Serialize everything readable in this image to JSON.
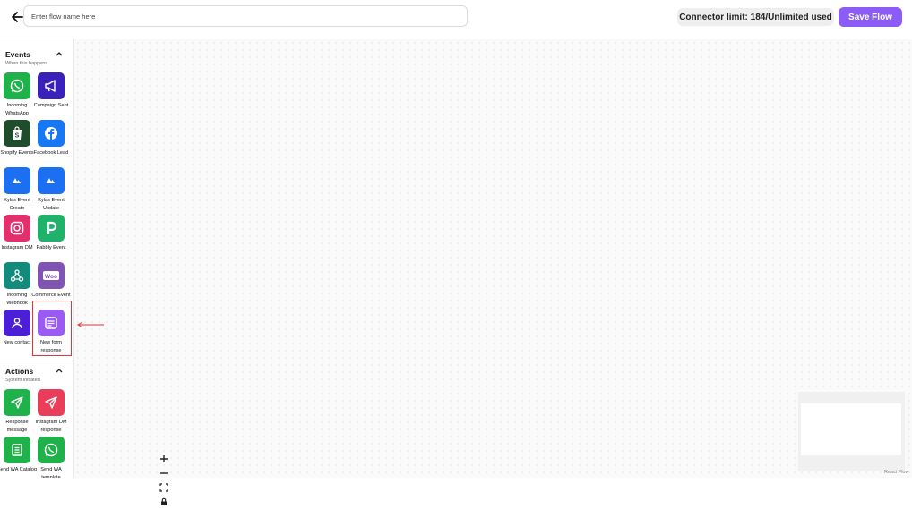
{
  "topbar": {
    "flow_name_placeholder": "Enter flow name here",
    "connector_limit": "Connector limit: 184/Unlimited used",
    "save_label": "Save Flow"
  },
  "colors": {
    "accent": "#8b5cf6",
    "highlight": "#d9363e"
  },
  "sidebar": {
    "events": {
      "title": "Events",
      "subtitle": "When this happens",
      "items": [
        {
          "label": "Incoming WhatsApp",
          "icon": "whatsapp-icon",
          "color": "#1fb14a"
        },
        {
          "label": "Campaign Sent",
          "icon": "megaphone-icon",
          "color": "#3a22b8"
        },
        {
          "label": "Shopify Events",
          "icon": "shopify-icon",
          "color": "#1f4d2b"
        },
        {
          "label": "Facebook Lead",
          "icon": "facebook-icon",
          "color": "#1877f2"
        },
        {
          "label": "Kylas Event Create",
          "icon": "kylas-icon",
          "color": "#1b6ff0"
        },
        {
          "label": "Kylas Event Update",
          "icon": "kylas-icon",
          "color": "#1b6ff0"
        },
        {
          "label": "Instagram DM",
          "icon": "instagram-icon",
          "color": "#e1306c"
        },
        {
          "label": "Pabbly Event",
          "icon": "pabbly-icon",
          "color": "#20b26b"
        },
        {
          "label": "Incoming Webhook",
          "icon": "webhook-icon",
          "color": "#138b7a"
        },
        {
          "label": "Commerce Event",
          "icon": "woo-icon",
          "color": "#7f54b3"
        },
        {
          "label": "New contact",
          "icon": "person-icon",
          "color": "#4b1fd6"
        },
        {
          "label": "New form response",
          "icon": "form-icon",
          "color": "#9a5bf0"
        }
      ]
    },
    "actions": {
      "title": "Actions",
      "subtitle": "System initiated",
      "items": [
        {
          "label": "Response message",
          "icon": "send-icon",
          "color": "#1fb14a"
        },
        {
          "label": "Instagram DM response",
          "icon": "send-icon",
          "color": "#ea3d5a"
        },
        {
          "label": "Send WA Catalog",
          "icon": "catalog-icon",
          "color": "#1fb14a"
        },
        {
          "label": "Send WA template",
          "icon": "whatsapp-icon",
          "color": "#1fb14a"
        }
      ]
    }
  },
  "canvas": {
    "attribution": "React Flow"
  }
}
